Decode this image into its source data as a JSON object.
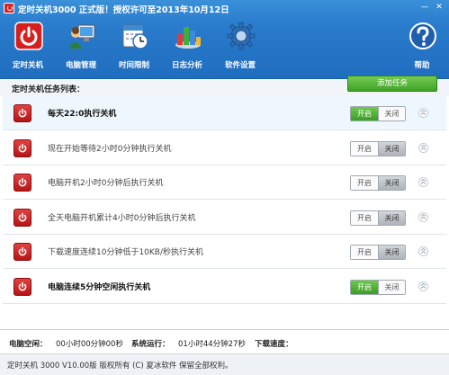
{
  "window": {
    "title": "定时关机3000 正式版！授权许可至2013年10月12日",
    "minimize_glyph": "—",
    "close_glyph": "✕"
  },
  "toolbar": {
    "items": [
      {
        "label": "定时关机",
        "icon": "power-icon"
      },
      {
        "label": "电脑管理",
        "icon": "computer-user-icon"
      },
      {
        "label": "时间限制",
        "icon": "calendar-clock-icon"
      },
      {
        "label": "日志分析",
        "icon": "bar-chart-icon"
      },
      {
        "label": "软件设置",
        "icon": "gear-icon"
      },
      {
        "label": "帮助",
        "icon": "help-icon"
      }
    ]
  },
  "list": {
    "title": "定时关机任务列表：",
    "add_label": "添加任务",
    "toggle_on_label": "开启",
    "toggle_off_label": "关闭",
    "tasks": [
      {
        "text": "每天22:0执行关机",
        "enabled": true
      },
      {
        "text": "现在开始等待2小时0分钟执行关机",
        "enabled": false
      },
      {
        "text": "电脑开机2小时0分钟后执行关机",
        "enabled": false
      },
      {
        "text": "全天电脑开机累计4小时0分钟后执行关机",
        "enabled": false
      },
      {
        "text": "下载速度连续10分钟低于10KB/秒执行关机",
        "enabled": false
      },
      {
        "text": "电脑连续5分钟空闲执行关机",
        "enabled": true
      }
    ]
  },
  "status": {
    "idle_label": "电脑空闲：",
    "idle_value": "00小时00分钟00秒",
    "uptime_label": "系统运行：",
    "uptime_value": "01小时44分钟27秒",
    "download_label": "下载速度："
  },
  "footer": {
    "text": "定时关机 3000 V10.00版  版权所有 (C) 夏冰软件 保留全部权利。"
  },
  "colors": {
    "header_blue": "#2a7ccd",
    "accent_green": "#3ea224",
    "task_red": "#c41d1d"
  }
}
